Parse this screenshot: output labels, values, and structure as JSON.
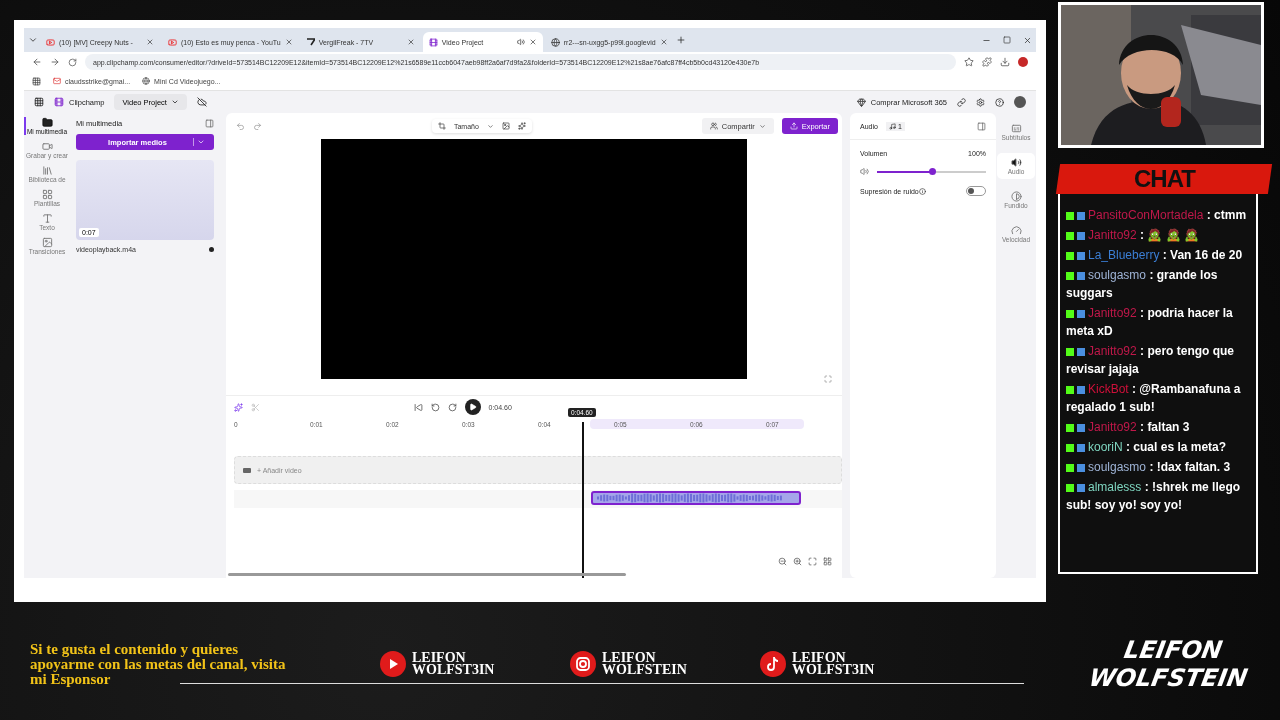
{
  "browser": {
    "tabs": [
      {
        "title": "(10) [MV] Creepy Nuts -",
        "kind": "youtube",
        "selected": false
      },
      {
        "title": "(10) Esto es muy penca - YouTu",
        "kind": "youtube",
        "selected": false
      },
      {
        "title": "VergilFreak - 7TV",
        "kind": "seventv",
        "selected": false
      },
      {
        "title": "Video Project",
        "kind": "clipchamp",
        "selected": true
      },
      {
        "title": "rr2---sn-uxgg5-p99l.googlevid",
        "kind": "web",
        "selected": false
      }
    ],
    "url": "app.clipchamp.com/consumer/editor/?driveId=573514BC12209E12&itemId=573514BC12209E12%21s6589e11ccb6047aeb98ff2a6af7d9fa2&folderId=573514BC12209E12%21s8ae76afc87ff4cb5b0cd43120e430e7b",
    "bookmarks": [
      {
        "label": "claudsstrike@gmai...",
        "kind": "mail"
      },
      {
        "label": "Mini Cd Videojuego...",
        "kind": "web"
      }
    ]
  },
  "app": {
    "brand": "Clipchamp",
    "project": "Video Project",
    "upgrade": "Comprar Microsoft 365",
    "rail": [
      {
        "label": "Mi multimedia",
        "kind": "media",
        "selected": true
      },
      {
        "label": "Grabar y crear",
        "kind": "record",
        "selected": false
      },
      {
        "label": "Biblioteca de",
        "kind": "library",
        "selected": false
      },
      {
        "label": "Plantillas",
        "kind": "templates",
        "selected": false
      },
      {
        "label": "Texto",
        "kind": "text",
        "selected": false
      },
      {
        "label": "Transiciones",
        "kind": "transitions",
        "selected": false
      }
    ],
    "media": {
      "title": "Mi multimedia",
      "import": "Importar medios",
      "items": [
        {
          "duration": "0:07",
          "name": "videoplayback.m4a"
        }
      ]
    },
    "preview": {
      "size": "Tamaño",
      "share": "Compartir",
      "export": "Exportar"
    },
    "audio": {
      "title": "Audio",
      "count": "1",
      "volume_label": "Volumen",
      "volume_value": "100%",
      "level": 0.5,
      "noise_label": "Supresión de ruido",
      "noise_on": false
    },
    "right_rail": [
      {
        "label": "Subtítulos",
        "kind": "captions",
        "selected": false
      },
      {
        "label": "Audio",
        "kind": "audio",
        "selected": true
      },
      {
        "label": "Fundido",
        "kind": "fade",
        "selected": false
      },
      {
        "label": "Velocidad",
        "kind": "speed",
        "selected": false
      }
    ],
    "timeline": {
      "time": "0:04.60",
      "playhead": "0:04.60",
      "ticks": [
        "0",
        "0:01",
        "0:02",
        "0:03",
        "0:04",
        "0:05",
        "0:06",
        "0:07"
      ],
      "add_video": "+ Añadir video"
    }
  },
  "overlay": {
    "chat_title": "CHAT",
    "chat": [
      {
        "user": "PansitoConMortadela",
        "color": "#c0184a",
        "text": ": ctmm"
      },
      {
        "user": "Janitto92",
        "color": "#c0184a",
        "text": ": 🧟 🧟 🧟"
      },
      {
        "user": "La_Blueberry",
        "color": "#3b7fd6",
        "text": ": Van 16 de 20"
      },
      {
        "user": "soulgasmo",
        "color": "#9fb4d6",
        "text": ": grande los suggars"
      },
      {
        "user": "Janitto92",
        "color": "#c0184a",
        "text": ": podria hacer la meta xD"
      },
      {
        "user": "Janitto92",
        "color": "#c0184a",
        "text": ": pero tengo que revisar jajaja"
      },
      {
        "user": "KickBot",
        "color": "#d0103a",
        "text": ": @Rambanafuna a regalado 1 sub!"
      },
      {
        "user": "Janitto92",
        "color": "#c0184a",
        "text": ": faltan 3"
      },
      {
        "user": "kooriN",
        "color": "#7fd6c0",
        "text": ": cual es la meta?"
      },
      {
        "user": "soulgasmo",
        "color": "#9fb4d6",
        "text": ": !dax faltan. 3"
      },
      {
        "user": "almalesss",
        "color": "#7fd6c0",
        "text": ": !shrek me llego sub! soy yo! soy yo!"
      }
    ],
    "banner": "Si te gusta el contenido y quieres apoyarme con las metas del canal, visita mi Esponsor",
    "socials": [
      {
        "kind": "youtube",
        "lines": [
          "LEIFON",
          "WOLFST3IN"
        ]
      },
      {
        "kind": "instagram",
        "lines": [
          "LEIFON",
          "WOLFSTEIN"
        ]
      },
      {
        "kind": "tiktok",
        "lines": [
          "LEIFON",
          "WOLFST3IN"
        ]
      }
    ],
    "logo": [
      "LEIFON",
      "WOLFSTEIN"
    ]
  }
}
